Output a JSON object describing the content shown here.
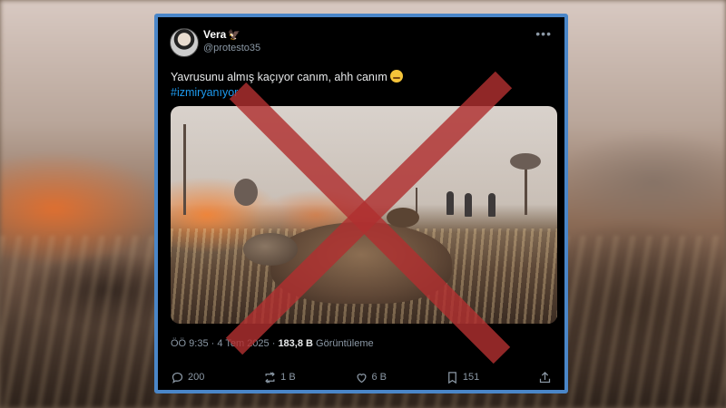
{
  "tweet": {
    "display_name": "Vera",
    "badge": "🦅",
    "handle": "@protesto35",
    "text": "Yavrusunu almış kaçıyor canım, ahh canım",
    "hashtag": "#izmiryanıyor",
    "time": "ÖÖ 9:35",
    "date": "4 Tem 2025",
    "views_count": "183,8 B",
    "views_label": "Görüntüleme"
  },
  "actions": {
    "reply_count": "200",
    "retweet_count": "1 B",
    "like_count": "6 B",
    "bookmark_count": "151"
  },
  "colors": {
    "accent": "#1d9bf0",
    "card_border": "#4a86c8",
    "cross_mark": "#b03030"
  }
}
